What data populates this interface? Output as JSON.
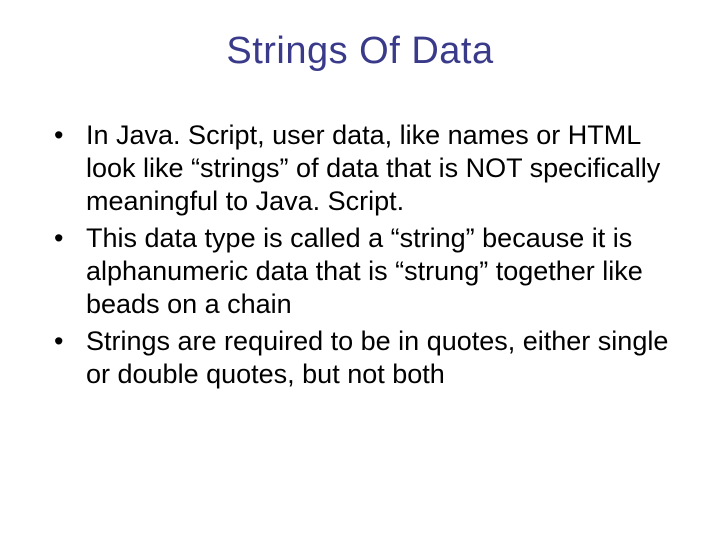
{
  "slide": {
    "title": "Strings Of Data",
    "bullets": [
      "In Java. Script, user data, like names or HTML look like “strings” of data that is NOT specifically meaningful to Java. Script.",
      "This data type is called a “string” because it is alphanumeric data that is “strung” together like beads on a chain",
      "Strings are required to be in quotes, either single or double quotes, but not both"
    ]
  }
}
